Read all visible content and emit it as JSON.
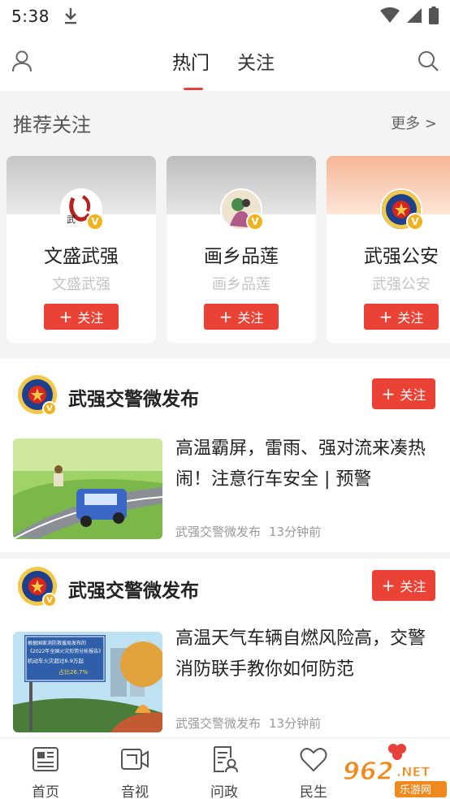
{
  "status_bar": {
    "time": "5:38"
  },
  "top_nav": {
    "tabs": [
      {
        "label": "热门",
        "active": true
      },
      {
        "label": "关注",
        "active": false
      }
    ]
  },
  "recommend": {
    "title": "推荐关注",
    "more": "更多 >",
    "cards": [
      {
        "name": "文盛武强",
        "sub": "文盛武强",
        "follow": "关注",
        "badge": "V",
        "avatar_text": "武"
      },
      {
        "name": "画乡品莲",
        "sub": "画乡品莲",
        "follow": "关注",
        "badge": "V"
      },
      {
        "name": "武强公安",
        "sub": "武强公安",
        "follow": "关注",
        "badge": "V"
      }
    ]
  },
  "feed": [
    {
      "author": "武强交警微发布",
      "follow": "关注",
      "badge": "V",
      "title": "高温霸屏，雷雨、强对流来凑热闹！注意行车安全 | 预警",
      "source": "武强交警微发布",
      "time": "13分钟前"
    },
    {
      "author": "武强交警微发布",
      "follow": "关注",
      "badge": "V",
      "title": "高温天气车辆自燃风险高，交警消防联手教你如何防范",
      "source": "武强交警微发布",
      "time": "13分钟前",
      "thumb_text": [
        "根据国家消防救援局发布的",
        "《2022年全国火灾形势分析报告》",
        "机动车火灾超过6.9万起",
        "占比26.7%"
      ]
    }
  ],
  "bottom_nav": [
    {
      "label": "首页",
      "icon": "home-icon"
    },
    {
      "label": "音视",
      "icon": "video-icon"
    },
    {
      "label": "问政",
      "icon": "inquiry-icon"
    },
    {
      "label": "民生",
      "icon": "heart-icon"
    }
  ],
  "watermark": {
    "main": "962",
    "suffix": ".NET",
    "sub": "乐游网"
  },
  "colors": {
    "accent": "#ea4335",
    "badge": "#f0b21f",
    "section_bg": "#f4f4f4"
  }
}
